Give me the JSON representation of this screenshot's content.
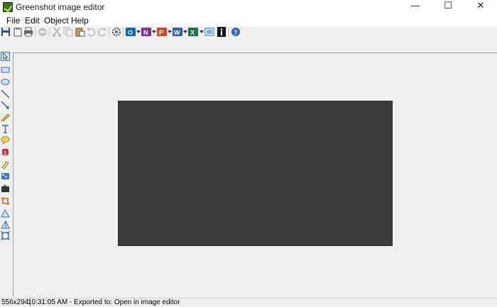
{
  "window": {
    "title": "Greenshot image editor",
    "minimize": "—",
    "maximize": "☐",
    "close": "✕"
  },
  "menu": {
    "items": [
      "File",
      "Edit",
      "Object",
      "Help"
    ]
  },
  "toolbar": {
    "icons": [
      "save-icon",
      "clipboard-icon",
      "print-icon",
      "delete-icon",
      "cut-icon",
      "copy-icon",
      "paste-icon",
      "undo-icon",
      "redo-icon",
      "settings-icon",
      "outlook-icon",
      "onenote-icon",
      "powerpoint-icon",
      "word-icon",
      "excel-icon",
      "editor-icon",
      "imgur-icon",
      "help-icon"
    ]
  },
  "tools": [
    "select-tool-icon",
    "rectangle-tool-icon",
    "ellipse-tool-icon",
    "line-tool-icon",
    "arrow-tool-icon",
    "freehand-tool-icon",
    "text-tool-icon",
    "speechbubble-tool-icon",
    "counter-tool-icon",
    "highlight-tool-icon",
    "obfuscate-tool-icon",
    "effects-tool-icon",
    "crop-tool-icon",
    "rotate-cw-tool-icon",
    "rotate-ccw-tool-icon",
    "resize-tool-icon"
  ],
  "colors": {
    "image_fill": "#3c3c3c",
    "canvas": "#f0f0f0",
    "accent": "#3c7fb1"
  },
  "status": {
    "dimensions": "556x294",
    "message": "10:31:05 AM - Exported to: Open in image editor"
  }
}
